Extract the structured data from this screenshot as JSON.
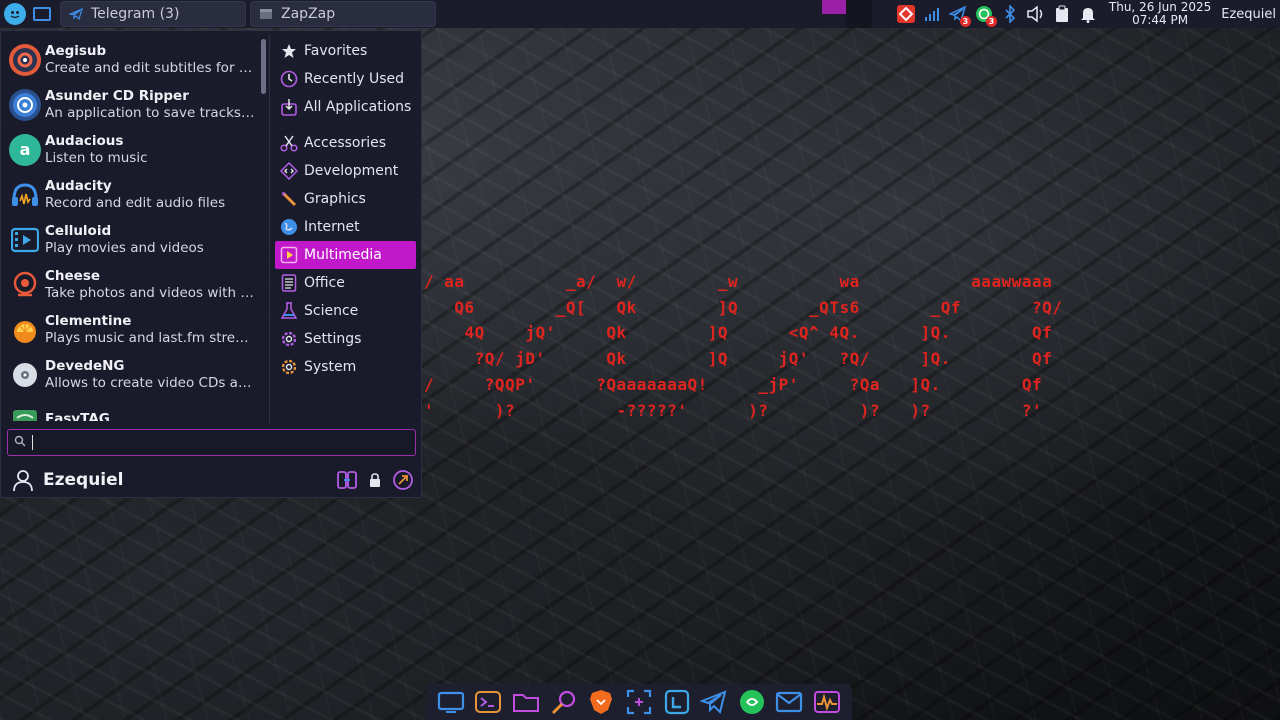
{
  "top_panel": {
    "tasks": [
      {
        "name": "Telegram (3)"
      },
      {
        "name": "ZapZap"
      }
    ],
    "clock": {
      "date": "Thu, 26 Jun 2025",
      "time": "07:44 PM"
    },
    "user": "Ezequiel",
    "tray_badges": {
      "telegram": "3",
      "whatsapp": "3"
    }
  },
  "app_menu": {
    "apps": [
      {
        "name": "Aegisub",
        "desc": "Create and edit subtitles for fil...",
        "icon": "aegisub-icon"
      },
      {
        "name": "Asunder CD Ripper",
        "desc": "An application to save tracks fr...",
        "icon": "cd-ripper-icon"
      },
      {
        "name": "Audacious",
        "desc": "Listen to music",
        "icon": "audacious-icon"
      },
      {
        "name": "Audacity",
        "desc": "Record and edit audio files",
        "icon": "audacity-icon"
      },
      {
        "name": "Celluloid",
        "desc": "Play movies and videos",
        "icon": "celluloid-icon"
      },
      {
        "name": "Cheese",
        "desc": "Take photos and videos with y...",
        "icon": "cheese-icon"
      },
      {
        "name": "Clementine",
        "desc": "Plays music and last.fm streams",
        "icon": "clementine-icon"
      },
      {
        "name": "DevedeNG",
        "desc": "Allows to create video CDs and...",
        "icon": "devede-icon"
      },
      {
        "name": "EasyTAG",
        "desc": "",
        "icon": "easytag-icon"
      }
    ],
    "categories": [
      {
        "label": "Favorites",
        "icon": "star-icon"
      },
      {
        "label": "Recently Used",
        "icon": "clock-icon"
      },
      {
        "label": "All Applications",
        "icon": "apps-icon"
      },
      {
        "label": "Accessories",
        "icon": "scissors-icon"
      },
      {
        "label": "Development",
        "icon": "code-icon"
      },
      {
        "label": "Graphics",
        "icon": "brush-icon"
      },
      {
        "label": "Internet",
        "icon": "globe-icon"
      },
      {
        "label": "Multimedia",
        "icon": "play-icon"
      },
      {
        "label": "Office",
        "icon": "document-icon"
      },
      {
        "label": "Science",
        "icon": "flask-icon"
      },
      {
        "label": "Settings",
        "icon": "gear-icon"
      },
      {
        "label": "System",
        "icon": "system-gear-icon"
      }
    ],
    "active_category": "Multimedia",
    "search": {
      "value": "",
      "placeholder": ""
    },
    "user_name": "Ezequiel"
  },
  "ascii_art": "/ aa          _a/  w/        _w          wa           aaawwaaa\n   Q6        _Q[   Qk        ]Q       _QTs6       _Qf       ?Q/\n    4Q    jQ'     Qk        ]Q      <Q^ 4Q.      ]Q.        Qf\n     ?Q/ jD'      Qk        ]Q     jQ'   ?Q/     ]Q.        Qf\n/     ?QQP'      ?QaaaaaaaQ!     _jP'     ?Qa   ]Q.        Qf\n'      )?          -?????'      )?         )?   )?         ?'",
  "colors": {
    "accent": "#c118c9",
    "panel_bg": "#1b1c2b",
    "menu_bg": "#1a1b2a",
    "ascii_red": "#e0241f"
  },
  "dock": [
    {
      "icon": "show-desktop-icon"
    },
    {
      "icon": "terminal-icon"
    },
    {
      "icon": "folder-icon"
    },
    {
      "icon": "search-files-icon"
    },
    {
      "icon": "brave-browser-icon"
    },
    {
      "icon": "screenshot-icon"
    },
    {
      "icon": "calendar-icon"
    },
    {
      "icon": "telegram-icon"
    },
    {
      "icon": "whatsapp-icon"
    },
    {
      "icon": "mail-icon"
    },
    {
      "icon": "system-monitor-icon"
    }
  ]
}
